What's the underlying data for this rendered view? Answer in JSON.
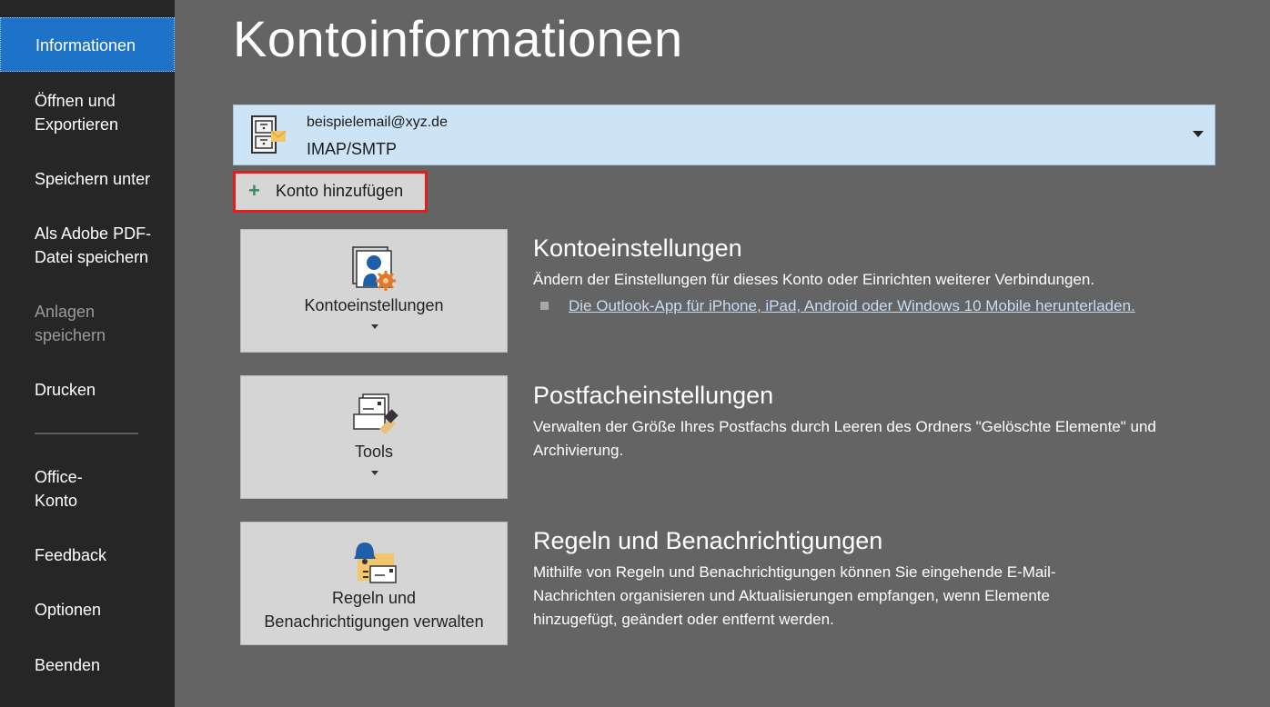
{
  "sidebar": {
    "items": [
      {
        "label": "Informationen",
        "active": true
      },
      {
        "label": "Öffnen und\nExportieren"
      },
      {
        "label": "Speichern unter"
      },
      {
        "label": "Als Adobe PDF-\nDatei speichern"
      },
      {
        "label": "Anlagen\nspeichern",
        "disabled": true
      },
      {
        "label": "Drucken"
      },
      {
        "label": "Office-\nKonto"
      },
      {
        "label": "Feedback"
      },
      {
        "label": "Optionen"
      },
      {
        "label": "Beenden"
      }
    ]
  },
  "main": {
    "title": "Kontoinformationen",
    "account": {
      "email": "beispielemail@xyz.de",
      "type": "IMAP/SMTP",
      "icon": "mail-account-cabinet-icon"
    },
    "add_account_label": "Konto hinzufügen",
    "sections": [
      {
        "tile_label": "Kontoeinstellungen",
        "tile_icon": "account-settings-icon",
        "heading": "Kontoeinstellungen",
        "description": "Ändern der Einstellungen für dieses Konto oder Einrichten weiterer Verbindungen.",
        "link": "Die Outlook-App für iPhone, iPad, Android oder Windows 10 Mobile herunterladen."
      },
      {
        "tile_label": "Tools",
        "tile_icon": "mailbox-cleanup-icon",
        "heading": "Postfacheinstellungen",
        "description": "Verwalten der Größe Ihres Postfachs durch Leeren des Ordners \"Gelöschte Elemente\" und Archivierung."
      },
      {
        "tile_label": "Regeln und\nBenachrichtigungen verwalten",
        "tile_icon": "rules-alerts-icon",
        "heading": "Regeln und Benachrichtigungen",
        "description": "Mithilfe von Regeln und Benachrichtigungen können Sie eingehende E-Mail-Nachrichten organisieren und Aktualisierungen empfangen, wenn Elemente hinzugefügt, geändert oder entfernt werden."
      }
    ]
  },
  "colors": {
    "sidebar_bg": "#262626",
    "active_item": "#1e73c8",
    "main_bg": "#646464",
    "account_bg": "#cde4f7",
    "highlight_border": "#e01e1e",
    "link": "#c6def5"
  }
}
